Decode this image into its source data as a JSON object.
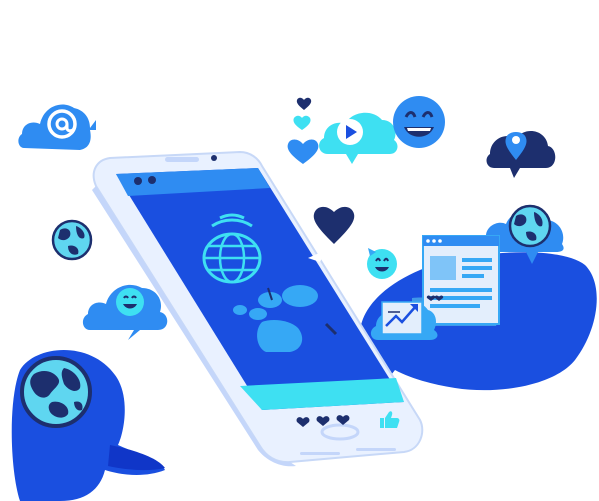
{
  "illustration": {
    "colors": {
      "primary_blue": "#1a4fe0",
      "deep_blue": "#1036c8",
      "screen_blue": "#2a5ef0",
      "light_blue": "#2f8cf2",
      "sky_blue": "#36a8f5",
      "cyan": "#3ee0f2",
      "aqua": "#5fd6f0",
      "navy": "#1d2f6e",
      "phone_body": "#e9f1ff",
      "white": "#ffffff"
    },
    "icons": [
      "at-sign-cloud-icon",
      "play-button-cloud-icon",
      "smiley-face-icon",
      "location-pin-cloud-icon",
      "globe-icon",
      "heart-icon",
      "smiley-cloud-icon",
      "growth-chart-cloud-icon",
      "web-page-window-icon",
      "smartphone-icon",
      "speech-bubble-icon",
      "like-thumb-icon"
    ]
  }
}
